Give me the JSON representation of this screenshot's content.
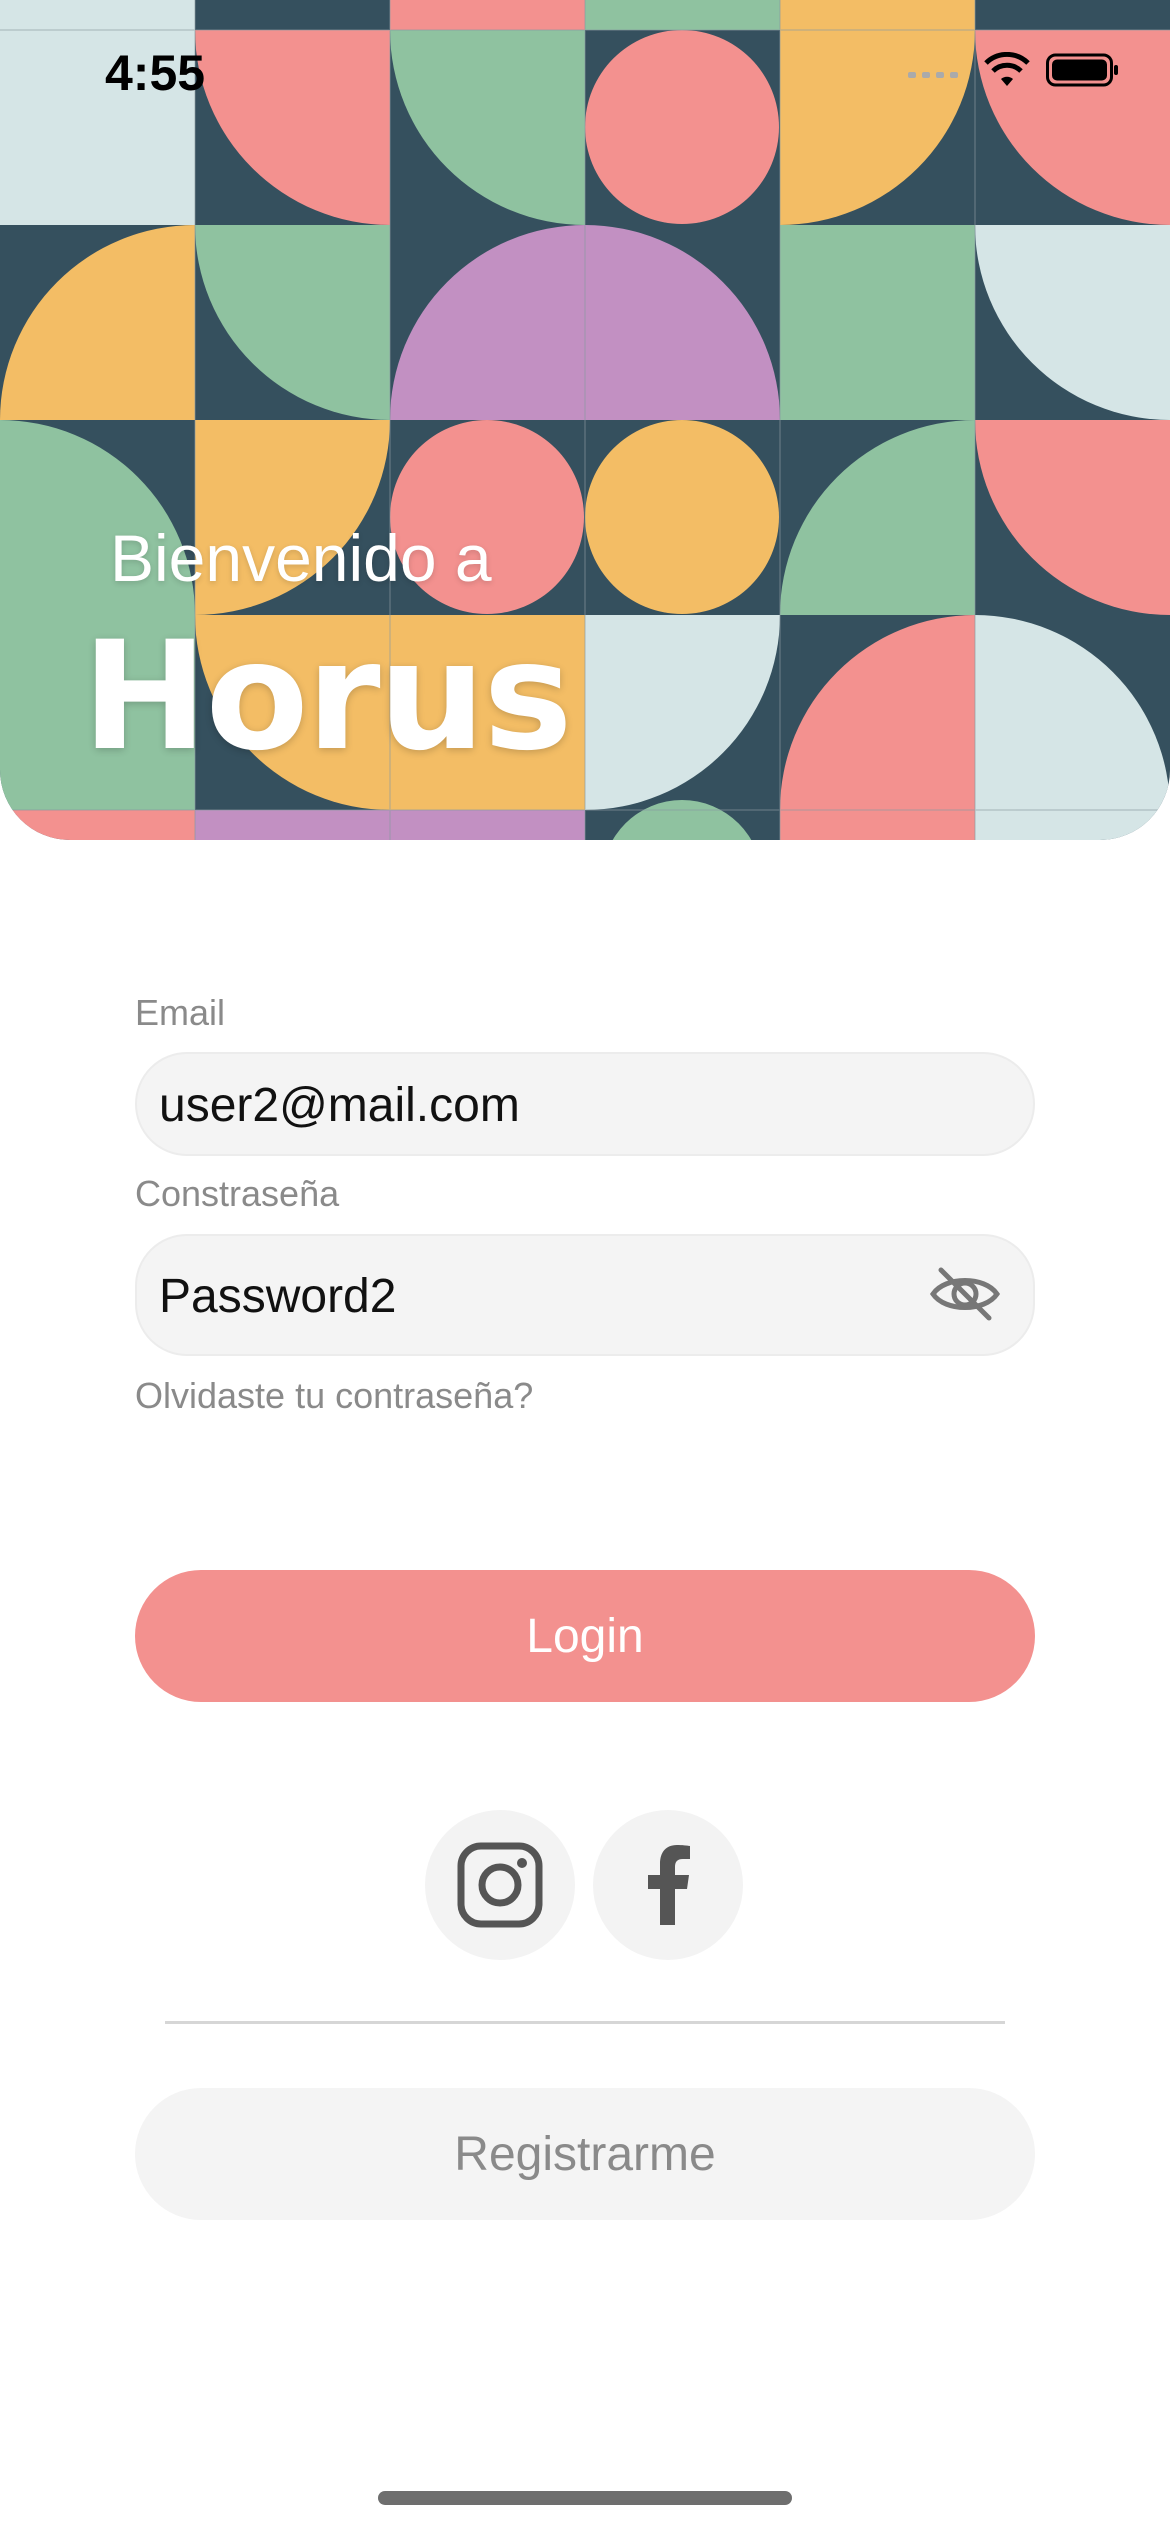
{
  "status_bar": {
    "time": "4:55"
  },
  "header": {
    "welcome": "Bienvenido a",
    "brand": "Horus"
  },
  "form": {
    "email_label": "Email",
    "email_value": "user2@mail.com",
    "password_label": "Constraseña",
    "password_value": "Password2",
    "forgot_link": "Olvidaste tu contraseña?"
  },
  "actions": {
    "login_label": "Login",
    "register_label": "Registrarme"
  },
  "social": {
    "icons": [
      "instagram-icon",
      "facebook-icon"
    ]
  },
  "colors": {
    "primary": "#f3918f",
    "pattern_navy": "#35505e",
    "pattern_green": "#8fc2a0",
    "pattern_yellow": "#f3bd65",
    "pattern_purple": "#c290c2",
    "pattern_light": "#d5e5e6",
    "field_bg": "#f4f4f4"
  }
}
